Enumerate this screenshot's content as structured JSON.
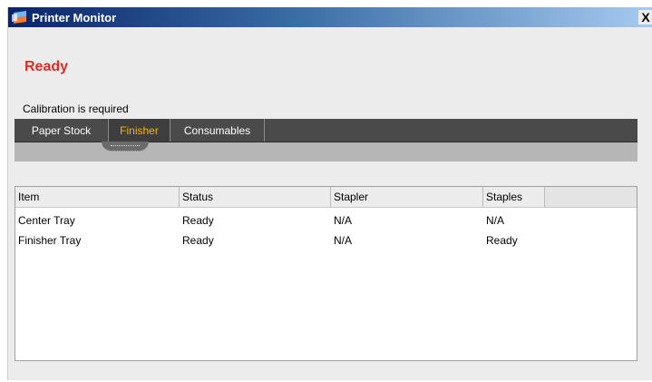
{
  "window": {
    "title": "Printer Monitor",
    "close_glyph": "X"
  },
  "status": {
    "heading": "Ready",
    "heading_color": "#e32b24",
    "message": "Calibration is required"
  },
  "tabs": [
    {
      "label": "Paper Stock",
      "selected": false
    },
    {
      "label": "Finisher",
      "selected": true
    },
    {
      "label": "Consumables",
      "selected": false
    }
  ],
  "colors": {
    "selected_tab_text": "#f5b800",
    "tabbar_bg": "#4a4a4a"
  },
  "table": {
    "columns": [
      "Item",
      "Status",
      "Stapler",
      "Staples"
    ],
    "rows": [
      [
        "Center Tray",
        "Ready",
        "N/A",
        "N/A"
      ],
      [
        "Finisher Tray",
        "Ready",
        "N/A",
        "Ready"
      ]
    ]
  },
  "icons": {
    "app_icon": "printer-monitor-icon",
    "close_icon": "close-icon"
  }
}
